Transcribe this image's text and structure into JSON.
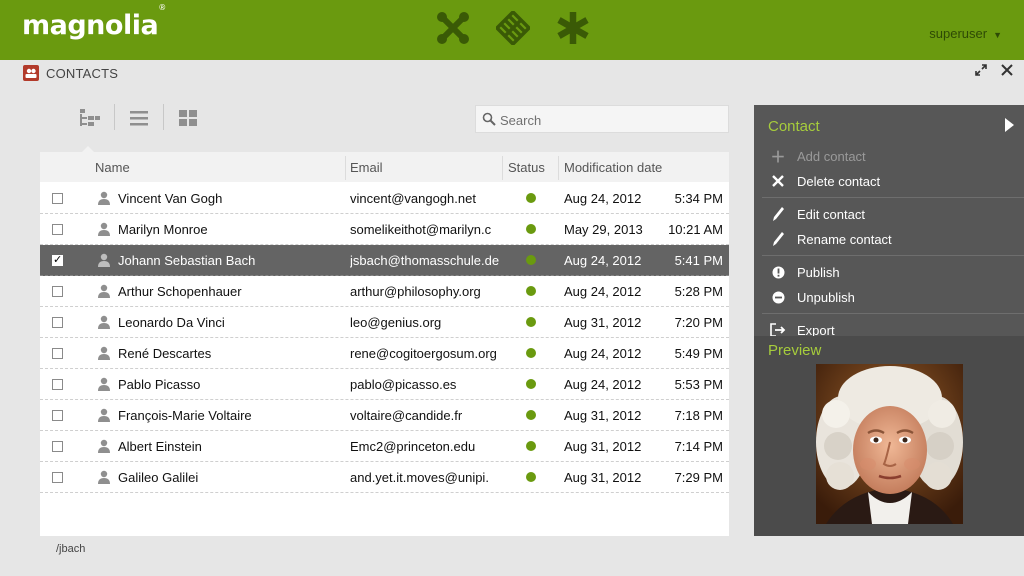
{
  "brand": {
    "logo": "magnolia",
    "logo_mark": "®"
  },
  "user": {
    "name": "superuser"
  },
  "app": {
    "title": "CONTACTS"
  },
  "search": {
    "placeholder": "Search"
  },
  "columns": {
    "name": "Name",
    "email": "Email",
    "status": "Status",
    "modification_date": "Modification date"
  },
  "contacts": [
    {
      "name": "Vincent Van Gogh",
      "email": "vincent@vangogh.net",
      "status": "published",
      "date": "Aug 24, 2012",
      "time": "5:34 PM",
      "checked": false
    },
    {
      "name": "Marilyn Monroe",
      "email": "somelikeithot@marilyn.c",
      "status": "published",
      "date": "May 29, 2013",
      "time": "10:21 AM",
      "checked": false
    },
    {
      "name": "Johann Sebastian Bach",
      "email": "jsbach@thomasschule.de",
      "status": "published",
      "date": "Aug 24, 2012",
      "time": "5:41 PM",
      "checked": true
    },
    {
      "name": "Arthur Schopenhauer",
      "email": "arthur@philosophy.org",
      "status": "published",
      "date": "Aug 24, 2012",
      "time": "5:28 PM",
      "checked": false
    },
    {
      "name": "Leonardo Da Vinci",
      "email": "leo@genius.org",
      "status": "published",
      "date": "Aug 31, 2012",
      "time": "7:20 PM",
      "checked": false
    },
    {
      "name": "René Descartes",
      "email": "rene@cogitoergosum.org",
      "status": "published",
      "date": "Aug 24, 2012",
      "time": "5:49 PM",
      "checked": false
    },
    {
      "name": "Pablo Picasso",
      "email": "pablo@picasso.es",
      "status": "published",
      "date": "Aug 24, 2012",
      "time": "5:53 PM",
      "checked": false
    },
    {
      "name": "François-Marie Voltaire",
      "email": "voltaire@candide.fr",
      "status": "published",
      "date": "Aug 31, 2012",
      "time": "7:18 PM",
      "checked": false
    },
    {
      "name": "Albert Einstein",
      "email": "Emc2@princeton.edu",
      "status": "published",
      "date": "Aug 31, 2012",
      "time": "7:14 PM",
      "checked": false
    },
    {
      "name": "Galileo Galilei",
      "email": "and.yet.it.moves@unipi.",
      "status": "published",
      "date": "Aug 31, 2012",
      "time": "7:29 PM",
      "checked": false
    }
  ],
  "path": "/jbach",
  "actionbar": {
    "section_title": "Contact",
    "add": "Add contact",
    "delete": "Delete contact",
    "edit": "Edit contact",
    "rename": "Rename contact",
    "publish": "Publish",
    "unpublish": "Unpublish",
    "export": "Export"
  },
  "preview": {
    "title": "Preview"
  },
  "colors": {
    "brand_green": "#6a9a0f",
    "accent_green": "#a6cc3c",
    "status_published": "#6a9a0f"
  }
}
